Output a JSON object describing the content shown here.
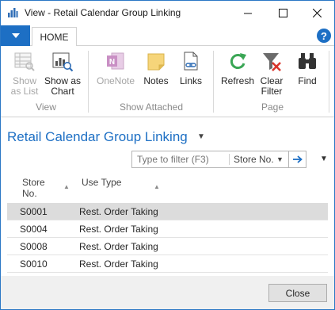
{
  "window": {
    "title": "View - Retail Calendar Group Linking",
    "controls": [
      "minimize-icon",
      "maximize-icon",
      "close-icon"
    ]
  },
  "ribbon": {
    "tab": "HOME",
    "help_icon": "?",
    "buttons": [
      {
        "label": "Show\nas List",
        "icon": "list-icon",
        "enabled": false
      },
      {
        "label": "Show as\nChart",
        "icon": "chart-icon",
        "enabled": true
      },
      {
        "label": "OneNote",
        "icon": "onenote-icon",
        "enabled": false
      },
      {
        "label": "Notes",
        "icon": "notes-icon",
        "enabled": true
      },
      {
        "label": "Links",
        "icon": "links-icon",
        "enabled": true
      },
      {
        "label": "Refresh",
        "icon": "refresh-icon",
        "enabled": true
      },
      {
        "label": "Clear\nFilter",
        "icon": "clear-filter-icon",
        "enabled": true
      },
      {
        "label": "Find",
        "icon": "binoculars-icon",
        "enabled": true
      }
    ],
    "groups": [
      "View",
      "Show Attached",
      "Page"
    ]
  },
  "page": {
    "title": "Retail Calendar Group Linking",
    "filter": {
      "placeholder": "Type to filter (F3)",
      "field": "Store No."
    }
  },
  "table": {
    "columns": [
      "Store\nNo.",
      "Use Type"
    ],
    "rows": [
      {
        "store": "S0001",
        "use_type": "Rest. Order Taking",
        "selected": true
      },
      {
        "store": "S0004",
        "use_type": "Rest. Order Taking",
        "selected": false
      },
      {
        "store": "S0008",
        "use_type": "Rest. Order Taking",
        "selected": false
      },
      {
        "store": "S0010",
        "use_type": "Rest. Order Taking",
        "selected": false
      }
    ]
  },
  "footer": {
    "close_label": "Close"
  },
  "colors": {
    "accent": "#1d6fc4",
    "selected_row": "#dcdcdc",
    "disabled_text": "#a6a6a6",
    "refresh_green": "#3aa655",
    "clear_filter_red": "#d9342b"
  }
}
